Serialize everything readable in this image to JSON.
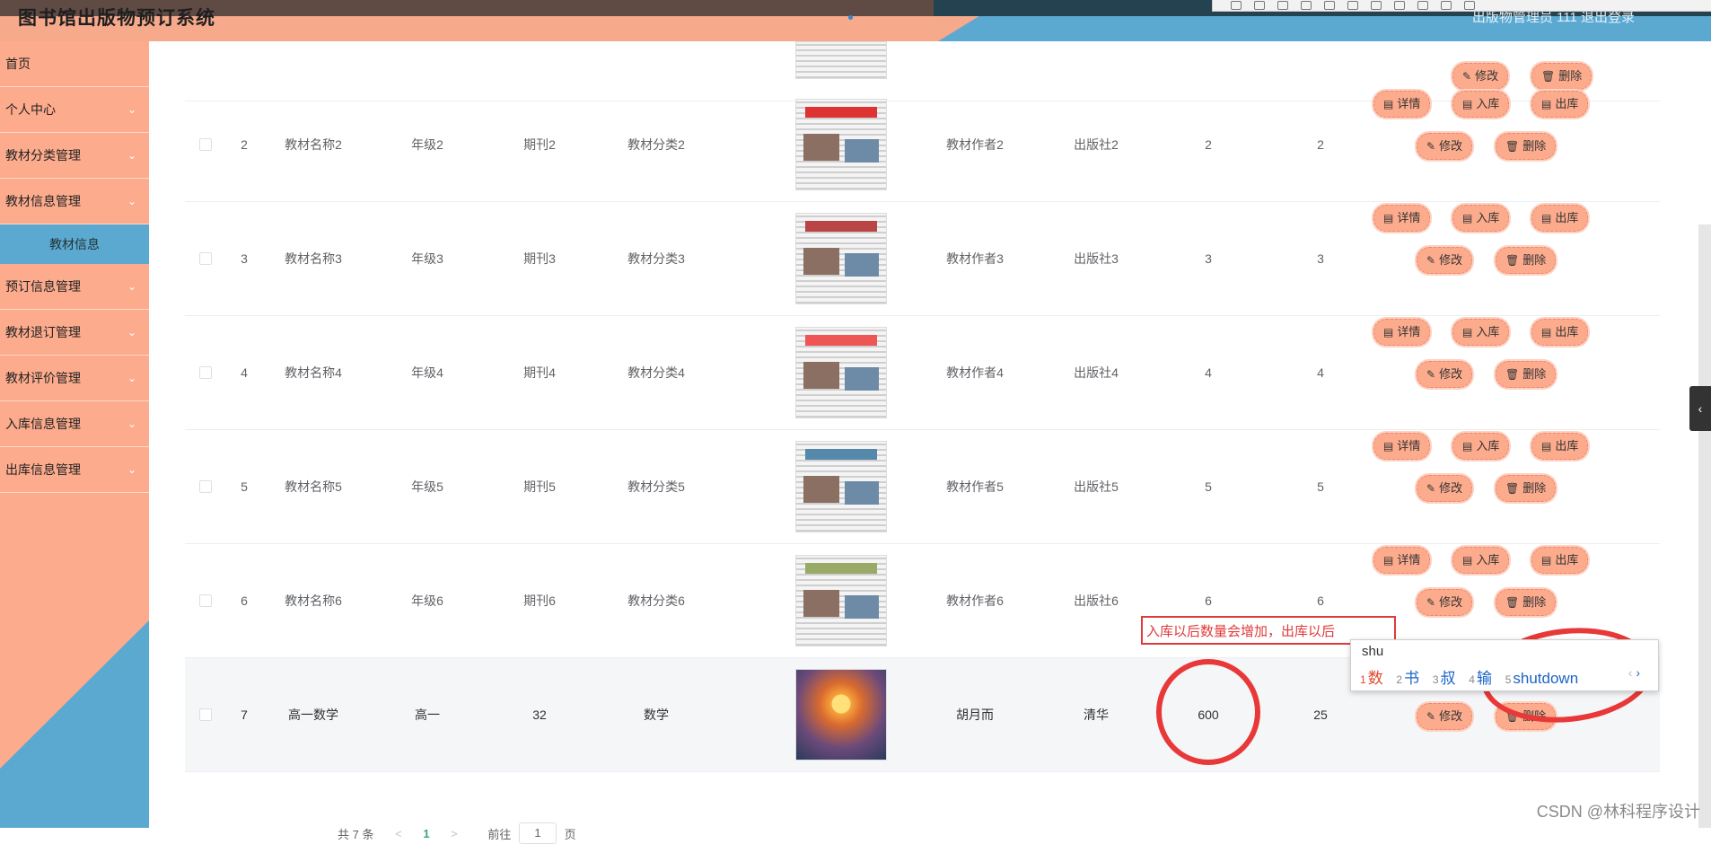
{
  "app_title": "图书馆出版物预订系统",
  "header_right": "出版物管理员 111   退出登录",
  "sidebar": {
    "items": [
      {
        "label": "首页",
        "chevron": false
      },
      {
        "label": "个人中心",
        "chevron": true
      },
      {
        "label": "教材分类管理",
        "chevron": true
      },
      {
        "label": "教材信息管理",
        "chevron": true
      }
    ],
    "active_sub": "教材信息",
    "items2": [
      {
        "label": "预订信息管理",
        "chevron": true
      },
      {
        "label": "教材退订管理",
        "chevron": true
      },
      {
        "label": "教材评价管理",
        "chevron": true
      },
      {
        "label": "入库信息管理",
        "chevron": true
      },
      {
        "label": "出库信息管理",
        "chevron": true
      }
    ]
  },
  "table": {
    "rows": [
      {
        "no": "2",
        "name": "教材名称2",
        "grade": "年级2",
        "issue": "期刊2",
        "category": "教材分类2",
        "author": "教材作者2",
        "publisher": "出版社2",
        "qty": "2",
        "price": "2",
        "thumb": "newspaper"
      },
      {
        "no": "3",
        "name": "教材名称3",
        "grade": "年级3",
        "issue": "期刊3",
        "category": "教材分类3",
        "author": "教材作者3",
        "publisher": "出版社3",
        "qty": "3",
        "price": "3",
        "thumb": "newspaper"
      },
      {
        "no": "4",
        "name": "教材名称4",
        "grade": "年级4",
        "issue": "期刊4",
        "category": "教材分类4",
        "author": "教材作者4",
        "publisher": "出版社4",
        "qty": "4",
        "price": "4",
        "thumb": "newspaper"
      },
      {
        "no": "5",
        "name": "教材名称5",
        "grade": "年级5",
        "issue": "期刊5",
        "category": "教材分类5",
        "author": "教材作者5",
        "publisher": "出版社5",
        "qty": "5",
        "price": "5",
        "thumb": "newspaper"
      },
      {
        "no": "6",
        "name": "教材名称6",
        "grade": "年级6",
        "issue": "期刊6",
        "category": "教材分类6",
        "author": "教材作者6",
        "publisher": "出版社6",
        "qty": "6",
        "price": "6",
        "thumb": "newspaper"
      },
      {
        "no": "7",
        "name": "高一数学",
        "grade": "高一",
        "issue": "32",
        "category": "数学",
        "author": "胡月而",
        "publisher": "清华",
        "qty": "600",
        "price": "25",
        "thumb": "sunset"
      }
    ],
    "buttons": {
      "detail": "详情",
      "in": "入库",
      "out": "出库",
      "edit": "修改",
      "delete": "删除"
    }
  },
  "pagination": {
    "total": "共 7 条",
    "current": "1",
    "goto_prefix": "前往",
    "goto_value": "1",
    "goto_suffix": "页"
  },
  "annotation_text": "入库以后数量会增加，出库以后",
  "ime": {
    "input": "shu",
    "candidates": [
      {
        "n": "1",
        "t": "数"
      },
      {
        "n": "2",
        "t": "书"
      },
      {
        "n": "3",
        "t": "叔"
      },
      {
        "n": "4",
        "t": "输"
      },
      {
        "n": "5",
        "t": "shutdown"
      }
    ]
  },
  "watermark": "CSDN @林科程序设计",
  "colors": {
    "sidebar_salmon": "#fcab8d",
    "sidebar_blue": "#5ba9d1",
    "button": "#fcab8d",
    "annotation_red": "#e83838"
  }
}
